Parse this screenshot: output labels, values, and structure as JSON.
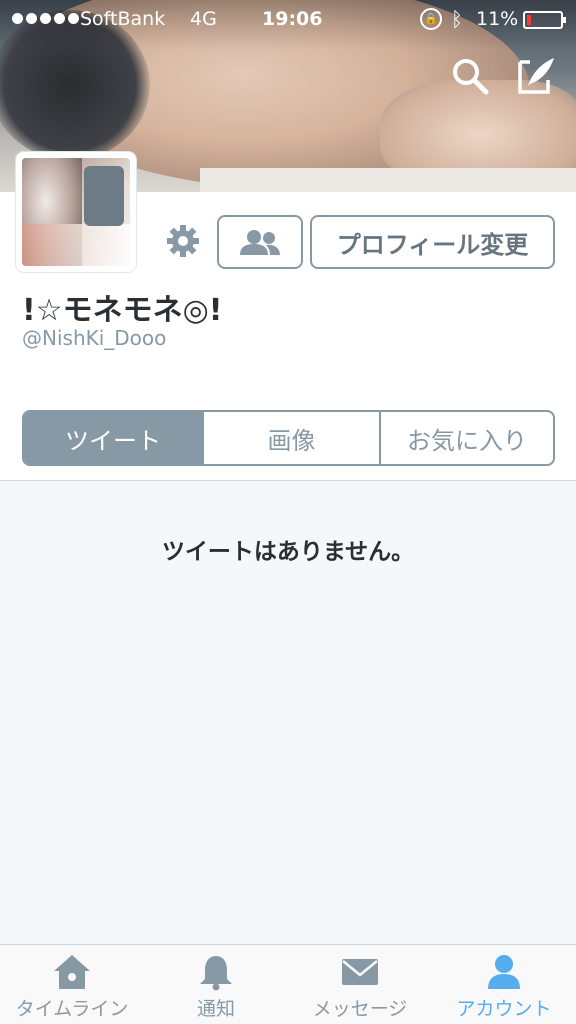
{
  "status_bar": {
    "carrier": "SoftBank",
    "network": "4G",
    "time": "19:06",
    "battery_percent": "11%",
    "battery_level": 0.11
  },
  "header": {
    "icons": [
      "search-icon",
      "compose-tweet-icon"
    ]
  },
  "profile": {
    "display_name": "!☆モネモネ◎!",
    "handle": "@NishKi_Dooo",
    "edit_profile_label": "プロフィール変更",
    "follow_icon": "people-icon",
    "settings_icon": "gear-icon"
  },
  "tabs": [
    {
      "label": "ツイート",
      "active": true
    },
    {
      "label": "画像",
      "active": false
    },
    {
      "label": "お気に入り",
      "active": false
    }
  ],
  "empty_state": "ツイートはありません。",
  "bottom_nav": [
    {
      "label": "タイムライン",
      "icon": "home-icon",
      "active": false
    },
    {
      "label": "通知",
      "icon": "bell-icon",
      "active": false
    },
    {
      "label": "メッセージ",
      "icon": "envelope-icon",
      "active": false
    },
    {
      "label": "アカウント",
      "icon": "person-icon",
      "active": true
    }
  ],
  "colors": {
    "accent": "#55acee",
    "inactive": "#8899a6",
    "battery_low": "#ff3b30"
  }
}
